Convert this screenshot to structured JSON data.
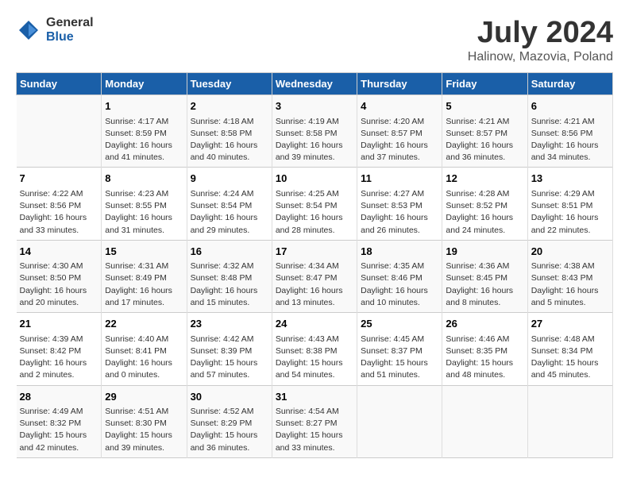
{
  "logo": {
    "general": "General",
    "blue": "Blue"
  },
  "title": "July 2024",
  "subtitle": "Halinow, Mazovia, Poland",
  "weekdays": [
    "Sunday",
    "Monday",
    "Tuesday",
    "Wednesday",
    "Thursday",
    "Friday",
    "Saturday"
  ],
  "weeks": [
    [
      {
        "day": "",
        "info": ""
      },
      {
        "day": "1",
        "info": "Sunrise: 4:17 AM\nSunset: 8:59 PM\nDaylight: 16 hours\nand 41 minutes."
      },
      {
        "day": "2",
        "info": "Sunrise: 4:18 AM\nSunset: 8:58 PM\nDaylight: 16 hours\nand 40 minutes."
      },
      {
        "day": "3",
        "info": "Sunrise: 4:19 AM\nSunset: 8:58 PM\nDaylight: 16 hours\nand 39 minutes."
      },
      {
        "day": "4",
        "info": "Sunrise: 4:20 AM\nSunset: 8:57 PM\nDaylight: 16 hours\nand 37 minutes."
      },
      {
        "day": "5",
        "info": "Sunrise: 4:21 AM\nSunset: 8:57 PM\nDaylight: 16 hours\nand 36 minutes."
      },
      {
        "day": "6",
        "info": "Sunrise: 4:21 AM\nSunset: 8:56 PM\nDaylight: 16 hours\nand 34 minutes."
      }
    ],
    [
      {
        "day": "7",
        "info": "Sunrise: 4:22 AM\nSunset: 8:56 PM\nDaylight: 16 hours\nand 33 minutes."
      },
      {
        "day": "8",
        "info": "Sunrise: 4:23 AM\nSunset: 8:55 PM\nDaylight: 16 hours\nand 31 minutes."
      },
      {
        "day": "9",
        "info": "Sunrise: 4:24 AM\nSunset: 8:54 PM\nDaylight: 16 hours\nand 29 minutes."
      },
      {
        "day": "10",
        "info": "Sunrise: 4:25 AM\nSunset: 8:54 PM\nDaylight: 16 hours\nand 28 minutes."
      },
      {
        "day": "11",
        "info": "Sunrise: 4:27 AM\nSunset: 8:53 PM\nDaylight: 16 hours\nand 26 minutes."
      },
      {
        "day": "12",
        "info": "Sunrise: 4:28 AM\nSunset: 8:52 PM\nDaylight: 16 hours\nand 24 minutes."
      },
      {
        "day": "13",
        "info": "Sunrise: 4:29 AM\nSunset: 8:51 PM\nDaylight: 16 hours\nand 22 minutes."
      }
    ],
    [
      {
        "day": "14",
        "info": "Sunrise: 4:30 AM\nSunset: 8:50 PM\nDaylight: 16 hours\nand 20 minutes."
      },
      {
        "day": "15",
        "info": "Sunrise: 4:31 AM\nSunset: 8:49 PM\nDaylight: 16 hours\nand 17 minutes."
      },
      {
        "day": "16",
        "info": "Sunrise: 4:32 AM\nSunset: 8:48 PM\nDaylight: 16 hours\nand 15 minutes."
      },
      {
        "day": "17",
        "info": "Sunrise: 4:34 AM\nSunset: 8:47 PM\nDaylight: 16 hours\nand 13 minutes."
      },
      {
        "day": "18",
        "info": "Sunrise: 4:35 AM\nSunset: 8:46 PM\nDaylight: 16 hours\nand 10 minutes."
      },
      {
        "day": "19",
        "info": "Sunrise: 4:36 AM\nSunset: 8:45 PM\nDaylight: 16 hours\nand 8 minutes."
      },
      {
        "day": "20",
        "info": "Sunrise: 4:38 AM\nSunset: 8:43 PM\nDaylight: 16 hours\nand 5 minutes."
      }
    ],
    [
      {
        "day": "21",
        "info": "Sunrise: 4:39 AM\nSunset: 8:42 PM\nDaylight: 16 hours\nand 2 minutes."
      },
      {
        "day": "22",
        "info": "Sunrise: 4:40 AM\nSunset: 8:41 PM\nDaylight: 16 hours\nand 0 minutes."
      },
      {
        "day": "23",
        "info": "Sunrise: 4:42 AM\nSunset: 8:39 PM\nDaylight: 15 hours\nand 57 minutes."
      },
      {
        "day": "24",
        "info": "Sunrise: 4:43 AM\nSunset: 8:38 PM\nDaylight: 15 hours\nand 54 minutes."
      },
      {
        "day": "25",
        "info": "Sunrise: 4:45 AM\nSunset: 8:37 PM\nDaylight: 15 hours\nand 51 minutes."
      },
      {
        "day": "26",
        "info": "Sunrise: 4:46 AM\nSunset: 8:35 PM\nDaylight: 15 hours\nand 48 minutes."
      },
      {
        "day": "27",
        "info": "Sunrise: 4:48 AM\nSunset: 8:34 PM\nDaylight: 15 hours\nand 45 minutes."
      }
    ],
    [
      {
        "day": "28",
        "info": "Sunrise: 4:49 AM\nSunset: 8:32 PM\nDaylight: 15 hours\nand 42 minutes."
      },
      {
        "day": "29",
        "info": "Sunrise: 4:51 AM\nSunset: 8:30 PM\nDaylight: 15 hours\nand 39 minutes."
      },
      {
        "day": "30",
        "info": "Sunrise: 4:52 AM\nSunset: 8:29 PM\nDaylight: 15 hours\nand 36 minutes."
      },
      {
        "day": "31",
        "info": "Sunrise: 4:54 AM\nSunset: 8:27 PM\nDaylight: 15 hours\nand 33 minutes."
      },
      {
        "day": "",
        "info": ""
      },
      {
        "day": "",
        "info": ""
      },
      {
        "day": "",
        "info": ""
      }
    ]
  ]
}
